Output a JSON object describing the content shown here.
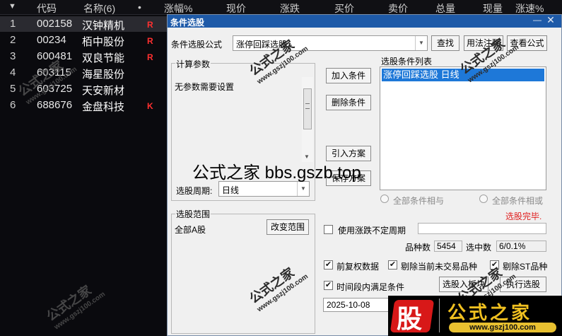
{
  "stock_list": {
    "columns": [
      "代码",
      "名称(6)",
      "•",
      "涨幅%",
      "现价",
      "涨跌",
      "买价",
      "卖价",
      "总量",
      "现量",
      "涨速%"
    ],
    "sort_icon": "triangle-down-icon",
    "rows": [
      {
        "num": "1",
        "code": "002158",
        "name": "汉钟精机",
        "flag": "R"
      },
      {
        "num": "2",
        "code": "00234",
        "name": "栢中股份",
        "flag": "R"
      },
      {
        "num": "3",
        "code": "600481",
        "name": "双良节能",
        "flag": "R"
      },
      {
        "num": "4",
        "code": "603115",
        "name": "海星股份",
        "flag": ""
      },
      {
        "num": "5",
        "code": "603725",
        "name": "天安新材",
        "flag": ""
      },
      {
        "num": "6",
        "code": "688676",
        "name": "金盘科技",
        "flag": "K"
      }
    ],
    "flag_color": "#ff3030"
  },
  "dialog": {
    "title": "条件选股",
    "minimize_glyph": "—",
    "close_glyph": "✕",
    "formula_label": "条件选股公式",
    "formula_value": "涨停回踩选股 -",
    "find_btn": "查找",
    "usage_btn": "用法注释",
    "view_btn": "查看公式",
    "params_title": "计算参数",
    "params_text": "无参数需要设置",
    "period_label": "选股周期:",
    "period_value": "日线",
    "add_btn": "加入条件",
    "delete_btn": "删除条件",
    "import_btn": "引入方案",
    "save_btn": "保存方案",
    "cond_list_title": "选股条件列表",
    "cond_items": [
      "涨停回踩选股  日线"
    ],
    "radio_and": "全部条件相与",
    "radio_or": "全部条件相或",
    "status": "选股完毕.",
    "status_color": "#e02020",
    "range_title": "选股范围",
    "range_value": "全部A股",
    "change_range_btn": "改变范围",
    "use_uncertain": "使用涨跌不定周期",
    "count_label": "品种数",
    "count_value": "5454",
    "selected_label": "选中数",
    "selected_value": "6/0.1%",
    "opt_prefuquan": "前复权数据",
    "opt_remove_notrade": "剔除当前未交易品种",
    "opt_remove_st": "剔除ST品种",
    "opt_time_range": "时间段内满足条件",
    "to_board_btn": "选股入板块",
    "run_btn": "执行选股",
    "date_value": "2025-10-08",
    "accent": "#1e5aa8"
  },
  "overlay_text": "公式之家 bbs.gszb.top",
  "watermarks": [
    {
      "big": "公式之家",
      "small": "www.gszj100.com"
    }
  ],
  "logo": {
    "char": "股",
    "title": "公式之家",
    "url": "www.gszj100.com"
  }
}
